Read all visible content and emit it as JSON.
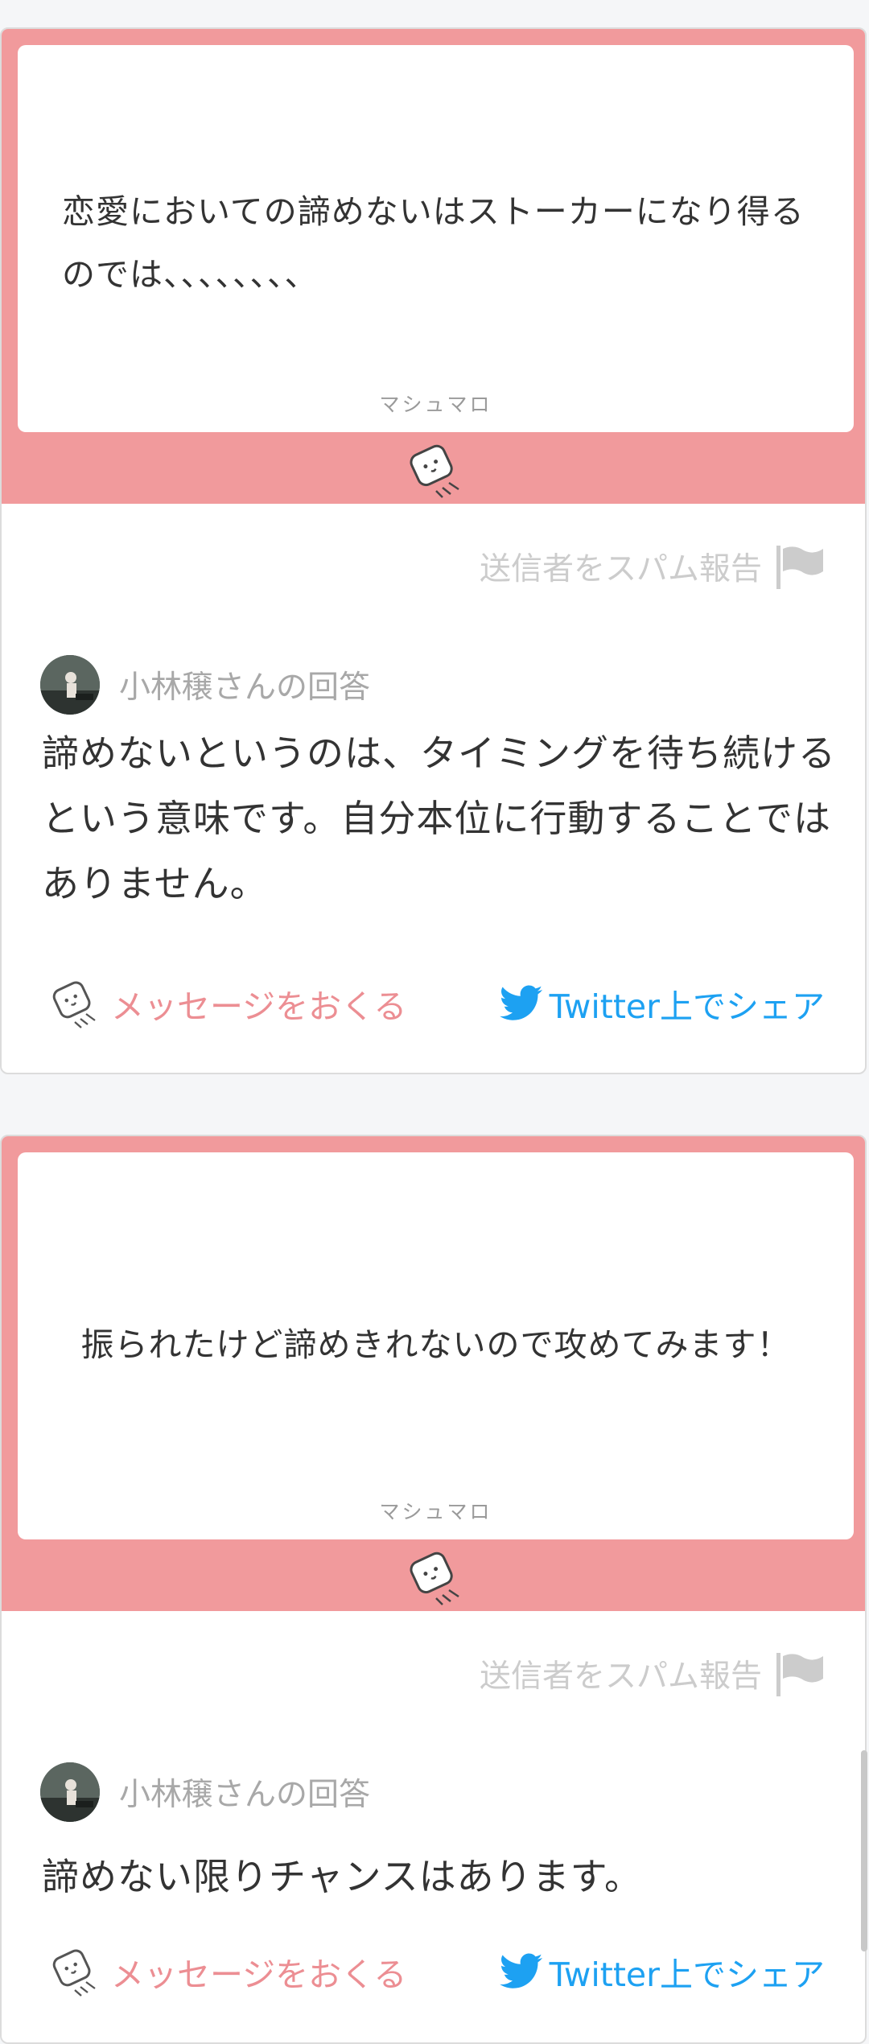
{
  "cards": [
    {
      "question": "恋愛においての諦めないはストーカーになり得るのでは、、、、、、、、",
      "brand": "マシュマロ",
      "spam_report": "送信者をスパム報告",
      "answerer": "小林穣さんの回答",
      "answer": "諦めないというのは、タイミングを待ち続けるという意味です。自分本位に行動することではありません。",
      "send_message": "メッセージをおくる",
      "share": "Twitter上でシェア"
    },
    {
      "question": "振られたけど諦めきれないので攻めてみます！",
      "brand": "マシュマロ",
      "spam_report": "送信者をスパム報告",
      "answerer": "小林穣さんの回答",
      "answer": "諦めない限りチャンスはあります。",
      "send_message": "メッセージをおくる",
      "share": "Twitter上でシェア"
    }
  ],
  "colors": {
    "frame_pink": "#f19a9c",
    "action_pink": "#ec8e93",
    "twitter_blue": "#1da1f2",
    "muted_gray": "#cccccc"
  },
  "icons": [
    "marshmallow-icon",
    "flag-icon",
    "twitter-bird-icon"
  ]
}
